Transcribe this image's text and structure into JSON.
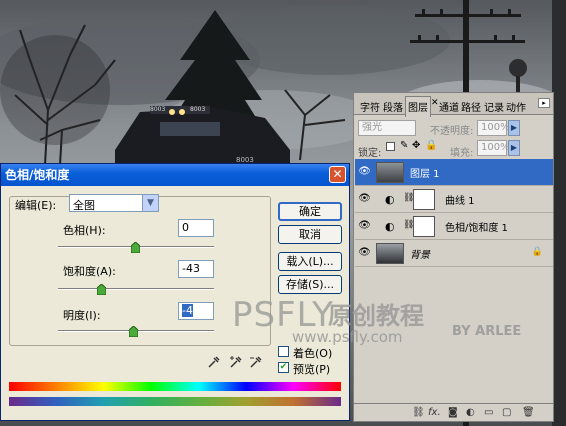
{
  "dialog": {
    "title": "色相/饱和度",
    "edit_label": "编辑(E):",
    "edit_value": "全图",
    "hue_label": "色相(H):",
    "hue_value": "0",
    "saturation_label": "饱和度(A):",
    "saturation_value": "-43",
    "lightness_label": "明度(I):",
    "lightness_value": "-4",
    "ok_label": "确定",
    "cancel_label": "取消",
    "load_label": "载入(L)...",
    "save_label": "存储(S)...",
    "colorize_label": "着色(O)",
    "colorize_checked": false,
    "preview_label": "预览(P)",
    "preview_checked": true
  },
  "layers_panel": {
    "tabs": [
      "字符",
      "段落",
      "图层",
      "通道",
      "路径",
      "记录",
      "动作"
    ],
    "active_tab": "图层",
    "blend_mode": "强光",
    "opacity_label": "不透明度:",
    "opacity_value": "100%",
    "lock_label": "锁定:",
    "fill_label": "填充:",
    "fill_value": "100%",
    "layers": [
      {
        "name": "图层 1",
        "active": true,
        "visible": true
      },
      {
        "name": "曲线 1",
        "active": false,
        "visible": true
      },
      {
        "name": "色相/饱和度 1",
        "active": false,
        "visible": true
      },
      {
        "name": "背景",
        "active": false,
        "visible": true
      }
    ]
  },
  "watermark": {
    "psfly": "PSFLY",
    "cn": "原创教程",
    "url": "www.psfly.com",
    "by": "BY ARLEE"
  },
  "colors": {
    "title_bar": "#0554d0",
    "dialog_bg": "#ece9d8",
    "panel_bg": "#d4d0c8",
    "selected_layer": "#316ac5"
  }
}
